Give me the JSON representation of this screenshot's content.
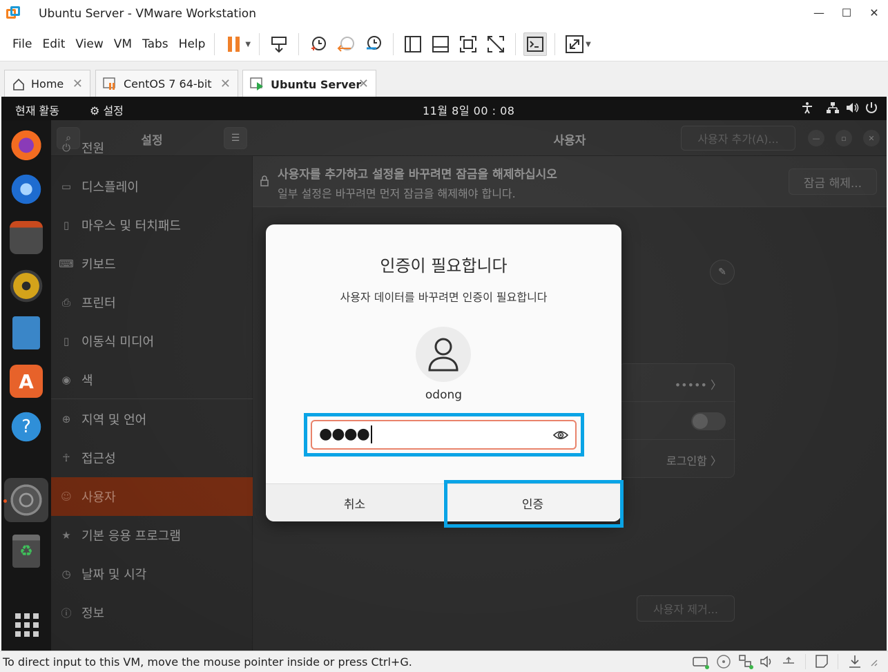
{
  "window": {
    "title": "Ubuntu Server - VMware Workstation",
    "minimize": "—",
    "maximize": "☐",
    "close": "✕"
  },
  "menu": {
    "items": [
      {
        "label": "File"
      },
      {
        "label": "Edit"
      },
      {
        "label": "View"
      },
      {
        "label": "VM"
      },
      {
        "label": "Tabs"
      },
      {
        "label": "Help"
      }
    ]
  },
  "tabs": [
    {
      "label": "Home",
      "icon": "home-icon"
    },
    {
      "label": "CentOS 7 64-bit",
      "icon": "vm-paused-icon"
    },
    {
      "label": "Ubuntu Server",
      "icon": "vm-running-icon",
      "active": true
    }
  ],
  "guest": {
    "topbar": {
      "activities": "현재 활동",
      "app_menu": "설정",
      "clock": "11월 8일  00 : 08"
    },
    "settings": {
      "sidebar_title": "설정",
      "items": [
        {
          "label": "전원",
          "icon": "power-icon"
        },
        {
          "label": "디스플레이",
          "icon": "display-icon"
        },
        {
          "label": "마우스 및 터치패드",
          "icon": "mouse-icon"
        },
        {
          "label": "키보드",
          "icon": "keyboard-icon"
        },
        {
          "label": "프린터",
          "icon": "printer-icon"
        },
        {
          "label": "이동식 미디어",
          "icon": "removable-media-icon"
        },
        {
          "label": "색",
          "icon": "color-icon"
        },
        {
          "label": "지역 및 언어",
          "icon": "globe-icon"
        },
        {
          "label": "접근성",
          "icon": "accessibility-icon"
        },
        {
          "label": "사용자",
          "icon": "users-icon",
          "selected": true
        },
        {
          "label": "기본 응용 프로그램",
          "icon": "star-icon"
        },
        {
          "label": "날짜 및 시각",
          "icon": "clock-icon"
        },
        {
          "label": "정보",
          "icon": "info-icon"
        }
      ],
      "content_title": "사용자",
      "add_user_button": "사용자 추가(A)...",
      "lock_title": "사용자를 추가하고 설정을 바꾸려면 잠금을 해제하십시오",
      "lock_subtitle": "일부 설정은 바꾸려면 먼저 잠금을 해제해야 합니다.",
      "unlock_button": "잠금 해제...",
      "password_masked": "•••••",
      "autologin_value": "로그인함",
      "remove_user_button": "사용자 제거..."
    },
    "auth_dialog": {
      "title": "인증이 필요합니다",
      "subtitle": "사용자 데이터를 바꾸려면 인증이 필요합니다",
      "username": "odong",
      "password_dots": "●●●●",
      "cancel_label": "취소",
      "authenticate_label": "인증"
    }
  },
  "statusbar": {
    "message": "To direct input to this VM, move the mouse pointer inside or press Ctrl+G."
  },
  "colors": {
    "highlight": "#0aa4e6",
    "ubuntu_orange": "#e95420",
    "vmware_orange": "#f58220"
  }
}
